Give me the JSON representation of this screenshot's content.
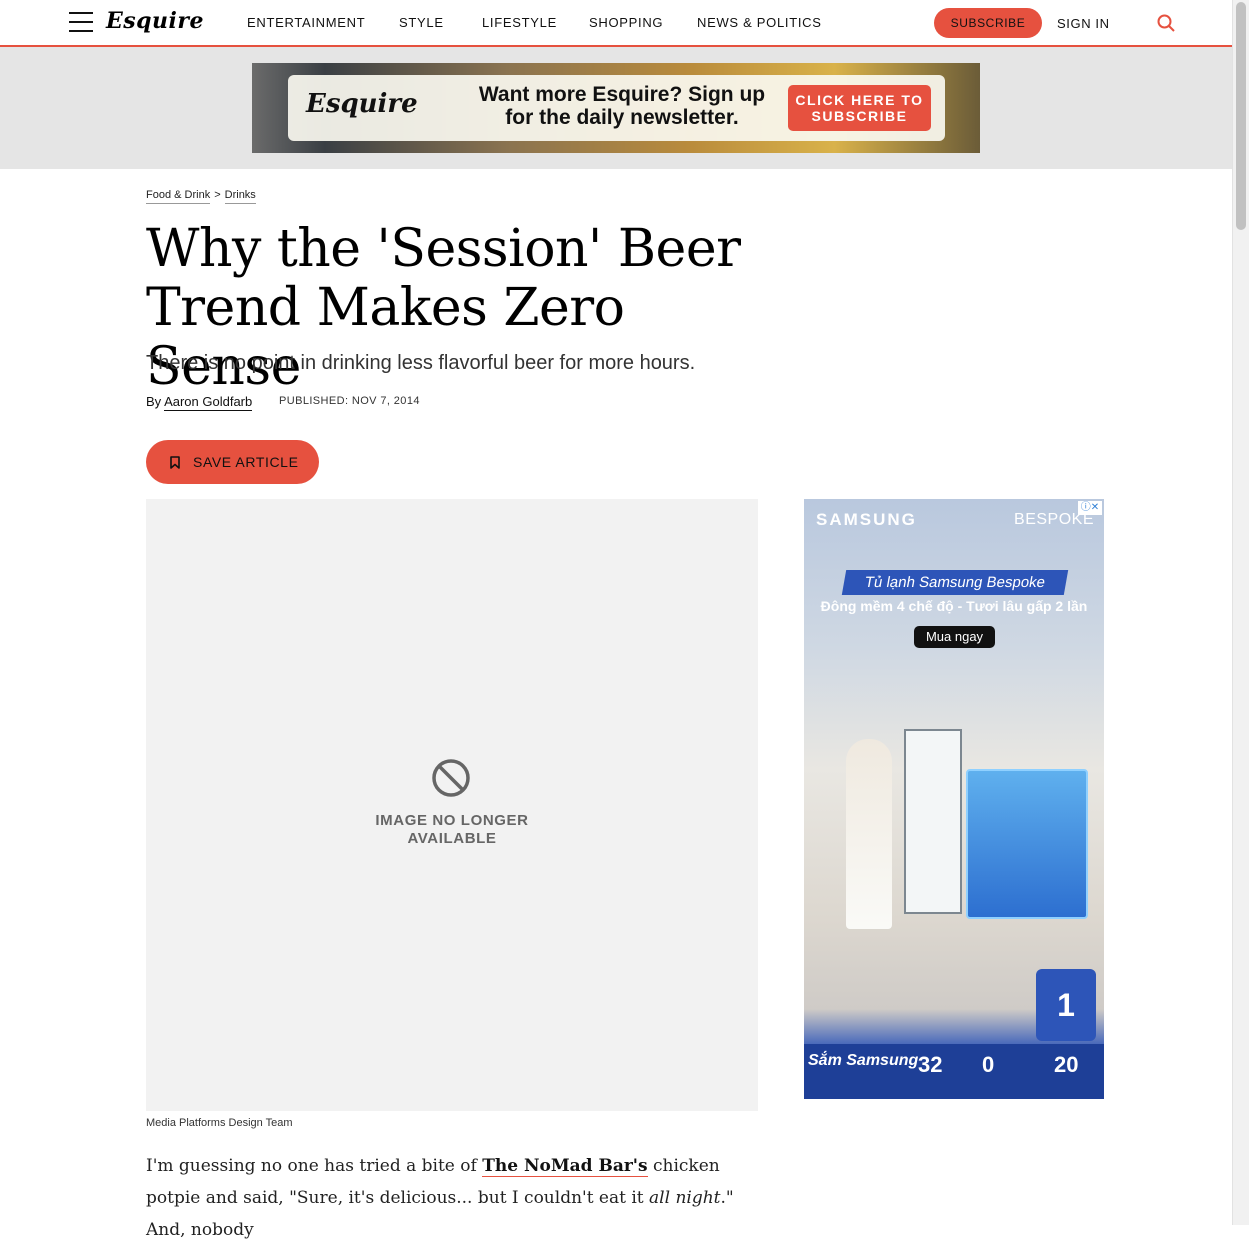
{
  "brand": {
    "logo": "Esquire",
    "accent_color": "#e6513f"
  },
  "nav": {
    "links": [
      "ENTERTAINMENT",
      "STYLE",
      "LIFESTYLE",
      "SHOPPING",
      "NEWS & POLITICS"
    ],
    "subscribe": "SUBSCRIBE",
    "sign_in": "SIGN IN"
  },
  "newsletter_ad": {
    "logo": "Esquire",
    "text": "Want more Esquire? Sign up for the daily newsletter.",
    "cta": "CLICK HERE TO SUBSCRIBE"
  },
  "breadcrumb": {
    "items": [
      "Food & Drink",
      "Drinks"
    ],
    "separator": ">"
  },
  "article": {
    "title": "Why the 'Session' Beer Trend Makes Zero Sense",
    "dek": "There is no point in drinking less flavorful beer for more hours.",
    "byline_prefix": "By",
    "author": "Aaron Goldfarb",
    "published": "PUBLISHED: NOV 7, 2014",
    "save_label": "SAVE ARTICLE",
    "image_unavailable": "IMAGE NO LONGER AVAILABLE",
    "image_caption": "Media Platforms Design Team",
    "body": {
      "p1_a": "I'm guessing no one has tried a bite of ",
      "p1_link": "The NoMad Bar's",
      "p1_b": " chicken potpie and said, \"Sure, it's delicious... but I couldn't eat it ",
      "p1_em": "all night",
      "p1_c": ".\" And, nobody"
    }
  },
  "side_ad": {
    "brand": "SAMSUNG",
    "product": "BESPOKE",
    "headline": "Tủ lạnh Samsung Bespoke",
    "subline": "Đông mềm 4 chế độ - Tươi lâu gấp 2 lần",
    "cta": "Mua ngay",
    "badge": "1",
    "promo_brand": "Sắm Samsung",
    "promo_values": [
      "32",
      "0",
      "20"
    ]
  }
}
